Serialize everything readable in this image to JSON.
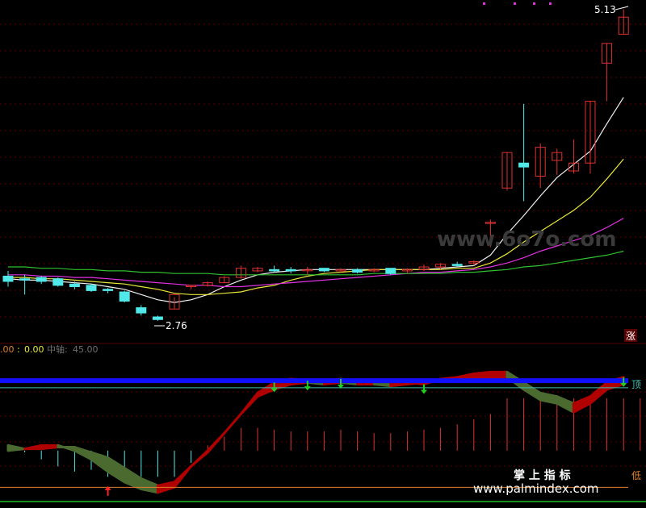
{
  "chart_data": [
    {
      "type": "candlestick",
      "panel": "main",
      "max_label": "5.13",
      "min_label": "2.76",
      "watermark": "www.6o7o.com",
      "corner_badge": "涨",
      "y_range_price": [
        2.6,
        5.2
      ],
      "ohlc": [
        {
          "o": 3.1,
          "h": 3.14,
          "c": 3.06,
          "l": 3.02
        },
        {
          "o": 3.08,
          "h": 3.11,
          "c": 3.07,
          "l": 2.96
        },
        {
          "o": 3.09,
          "h": 3.1,
          "c": 3.06,
          "l": 3.04
        },
        {
          "o": 3.08,
          "h": 3.09,
          "c": 3.03,
          "l": 3.02
        },
        {
          "o": 3.04,
          "h": 3.06,
          "c": 3.02,
          "l": 3.0
        },
        {
          "o": 3.03,
          "h": 3.04,
          "c": 2.99,
          "l": 2.98
        },
        {
          "o": 3.0,
          "h": 3.01,
          "c": 2.99,
          "l": 2.97
        },
        {
          "o": 2.98,
          "h": 2.99,
          "c": 2.91,
          "l": 2.9
        },
        {
          "o": 2.86,
          "h": 2.88,
          "c": 2.82,
          "l": 2.8
        },
        {
          "o": 2.79,
          "h": 2.8,
          "c": 2.77,
          "l": 2.76
        },
        {
          "o": 2.85,
          "h": 2.94,
          "c": 2.96,
          "l": 2.85
        },
        {
          "o": 3.02,
          "h": 3.03,
          "c": 3.03,
          "l": 3.0
        },
        {
          "o": 3.03,
          "h": 3.06,
          "c": 3.05,
          "l": 3.02
        },
        {
          "o": 3.05,
          "h": 3.1,
          "c": 3.09,
          "l": 3.05
        },
        {
          "o": 3.09,
          "h": 3.18,
          "c": 3.16,
          "l": 3.08
        },
        {
          "o": 3.14,
          "h": 3.17,
          "c": 3.16,
          "l": 3.13
        },
        {
          "o": 3.15,
          "h": 3.18,
          "c": 3.14,
          "l": 3.13
        },
        {
          "o": 3.15,
          "h": 3.17,
          "c": 3.14,
          "l": 3.12
        },
        {
          "o": 3.15,
          "h": 3.17,
          "c": 3.15,
          "l": 3.11
        },
        {
          "o": 3.16,
          "h": 3.16,
          "c": 3.14,
          "l": 3.13
        },
        {
          "o": 3.14,
          "h": 3.16,
          "c": 3.15,
          "l": 3.13
        },
        {
          "o": 3.15,
          "h": 3.16,
          "c": 3.13,
          "l": 3.12
        },
        {
          "o": 3.14,
          "h": 3.16,
          "c": 3.15,
          "l": 3.13
        },
        {
          "o": 3.16,
          "h": 3.16,
          "c": 3.12,
          "l": 3.11
        },
        {
          "o": 3.14,
          "h": 3.16,
          "c": 3.15,
          "l": 3.12
        },
        {
          "o": 3.15,
          "h": 3.19,
          "c": 3.17,
          "l": 3.14
        },
        {
          "o": 3.17,
          "h": 3.2,
          "c": 3.19,
          "l": 3.15
        },
        {
          "o": 3.19,
          "h": 3.21,
          "c": 3.18,
          "l": 3.17
        },
        {
          "o": 3.2,
          "h": 3.22,
          "c": 3.21,
          "l": 3.18
        },
        {
          "o": 3.5,
          "h": 3.53,
          "c": 3.51,
          "l": 3.32
        },
        {
          "o": 3.77,
          "h": 4.04,
          "c": 4.04,
          "l": 3.75
        },
        {
          "o": 3.96,
          "h": 4.41,
          "c": 3.93,
          "l": 3.67
        },
        {
          "o": 3.86,
          "h": 4.11,
          "c": 4.08,
          "l": 3.77
        },
        {
          "o": 3.98,
          "h": 4.07,
          "c": 4.04,
          "l": 3.87
        },
        {
          "o": 3.9,
          "h": 4.14,
          "c": 3.96,
          "l": 3.88
        },
        {
          "o": 3.96,
          "h": 4.43,
          "c": 4.43,
          "l": 3.88
        },
        {
          "o": 4.72,
          "h": 4.87,
          "c": 4.87,
          "l": 4.43
        },
        {
          "o": 4.94,
          "h": 5.13,
          "c": 5.07,
          "l": 4.94
        }
      ],
      "moving_averages": [
        {
          "name": "MA5",
          "color": "#f0f0f0",
          "values": [
            3.08,
            3.07,
            3.07,
            3.06,
            3.05,
            3.04,
            3.02,
            3.0,
            2.96,
            2.92,
            2.9,
            2.92,
            2.96,
            3.02,
            3.07,
            3.11,
            3.13,
            3.14,
            3.15,
            3.15,
            3.15,
            3.15,
            3.15,
            3.15,
            3.15,
            3.15,
            3.16,
            3.17,
            3.18,
            3.26,
            3.42,
            3.56,
            3.71,
            3.85,
            3.95,
            4.05,
            4.26,
            4.46
          ]
        },
        {
          "name": "MA10",
          "color": "#e8e83a",
          "values": [
            3.09,
            3.09,
            3.08,
            3.08,
            3.07,
            3.06,
            3.05,
            3.04,
            3.02,
            3.0,
            2.97,
            2.96,
            2.96,
            2.97,
            2.98,
            3.01,
            3.03,
            3.07,
            3.1,
            3.12,
            3.13,
            3.14,
            3.15,
            3.15,
            3.15,
            3.15,
            3.15,
            3.16,
            3.16,
            3.2,
            3.27,
            3.36,
            3.44,
            3.52,
            3.6,
            3.7,
            3.84,
            3.99
          ]
        },
        {
          "name": "MA20",
          "color": "#e030e0",
          "values": [
            3.11,
            3.11,
            3.1,
            3.1,
            3.09,
            3.09,
            3.08,
            3.07,
            3.06,
            3.05,
            3.04,
            3.03,
            3.03,
            3.02,
            3.02,
            3.03,
            3.04,
            3.05,
            3.06,
            3.07,
            3.08,
            3.09,
            3.1,
            3.11,
            3.12,
            3.13,
            3.13,
            3.14,
            3.15,
            3.17,
            3.2,
            3.24,
            3.29,
            3.33,
            3.37,
            3.41,
            3.47,
            3.54
          ]
        },
        {
          "name": "MA60",
          "color": "#30c030",
          "values": [
            3.17,
            3.17,
            3.16,
            3.16,
            3.15,
            3.15,
            3.14,
            3.14,
            3.13,
            3.13,
            3.12,
            3.12,
            3.12,
            3.11,
            3.11,
            3.11,
            3.11,
            3.11,
            3.11,
            3.11,
            3.11,
            3.11,
            3.12,
            3.12,
            3.12,
            3.12,
            3.12,
            3.13,
            3.13,
            3.14,
            3.15,
            3.17,
            3.18,
            3.2,
            3.22,
            3.24,
            3.26,
            3.29
          ]
        }
      ]
    },
    {
      "type": "indicator",
      "panel": "sub",
      "header": {
        "v1": ".00",
        "sep": ":",
        "v2": "0.00",
        "mid_name": "中轴:",
        "mid_value": "45.00"
      },
      "top_label": "顶",
      "bottom_label": "低",
      "band_a": [
        48,
        46,
        46,
        47,
        47,
        44,
        41,
        35,
        29,
        25,
        27,
        36,
        44,
        55,
        66,
        78,
        84,
        86,
        85,
        85,
        86,
        84,
        85,
        85,
        84,
        83,
        86,
        87,
        89,
        90,
        90,
        84,
        78,
        76,
        72,
        76,
        84,
        87,
        90
      ],
      "band_b": [
        45,
        46,
        48,
        48,
        45,
        40,
        33,
        27,
        23,
        21,
        24,
        36,
        45,
        55,
        66,
        76,
        80,
        83,
        84,
        83,
        84,
        83,
        83,
        82,
        83,
        84,
        85,
        86,
        86,
        87,
        87,
        80,
        74,
        72,
        67,
        72,
        80,
        83,
        86
      ],
      "bars": [
        45,
        44,
        40,
        36,
        33,
        34,
        30,
        27,
        30,
        30,
        30,
        38,
        48,
        53,
        58,
        58,
        57,
        56,
        56,
        56,
        57,
        56,
        55,
        55,
        56,
        57,
        58,
        60,
        63,
        66,
        75,
        75,
        75,
        75,
        75,
        75,
        75,
        75,
        75
      ],
      "up_arrows": [
        6
      ],
      "down_arrows": [
        16,
        18,
        20,
        25,
        37
      ],
      "top_line": 81,
      "blue_line": 85,
      "bottom_line": 24,
      "y_range": [
        14,
        98
      ]
    }
  ],
  "footer": {
    "title": "掌 上 指 标",
    "url": "www.palmindex.com"
  },
  "colors": {
    "up": "#e03030",
    "down": "#50e8e8",
    "grid": "#5a0000",
    "blue": "#1010ff",
    "teal": "#40c0b0",
    "orange": "#e08030",
    "green": "#20c020"
  }
}
